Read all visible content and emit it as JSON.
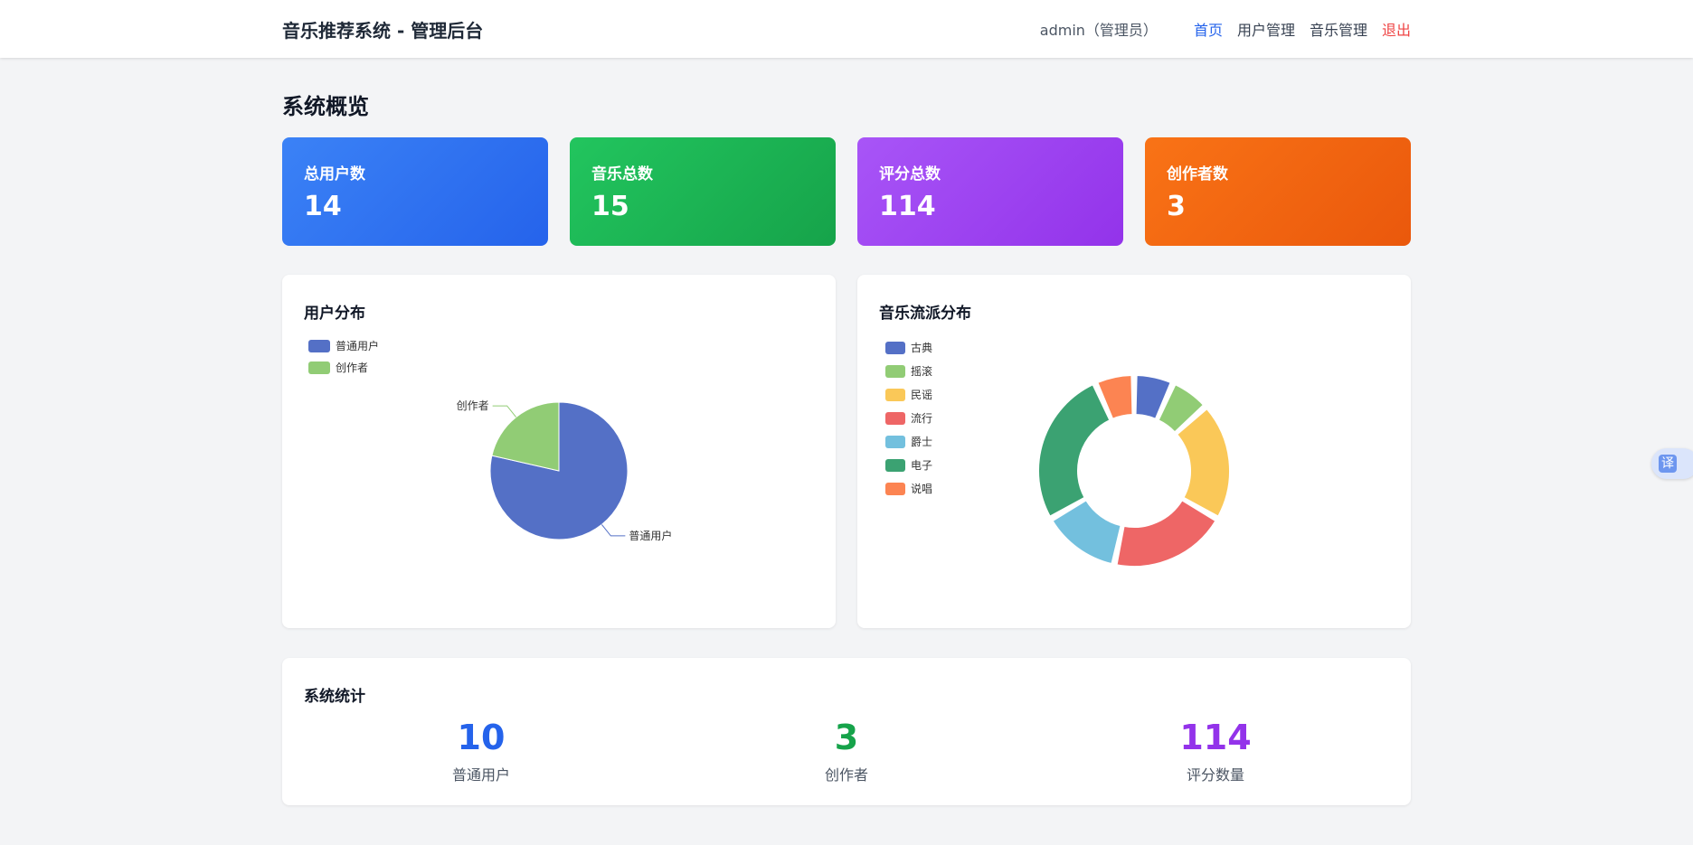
{
  "header": {
    "brand": "音乐推荐系统 - 管理后台",
    "user": "admin（管理员）",
    "nav": [
      {
        "label": "首页",
        "active": true
      },
      {
        "label": "用户管理",
        "active": false
      },
      {
        "label": "音乐管理",
        "active": false
      },
      {
        "label": "退出",
        "active": false
      }
    ]
  },
  "page_title": "系统概览",
  "stats": [
    {
      "label": "总用户数",
      "value": "14"
    },
    {
      "label": "音乐总数",
      "value": "15"
    },
    {
      "label": "评分总数",
      "value": "114"
    },
    {
      "label": "创作者数",
      "value": "3"
    }
  ],
  "charts": {
    "users_title": "用户分布",
    "genre_title": "音乐流派分布"
  },
  "chart_data": [
    {
      "type": "pie",
      "title": "用户分布",
      "categories": [
        "普通用户",
        "创作者"
      ],
      "values": [
        11,
        3
      ],
      "colors": [
        "#5470c6",
        "#91cc75"
      ],
      "legend": "top-left"
    },
    {
      "type": "pie",
      "title": "音乐流派分布",
      "categories": [
        "古典",
        "摇滚",
        "民谣",
        "流行",
        "爵士",
        "电子",
        "说唱"
      ],
      "values": [
        1,
        1,
        3,
        3,
        2,
        4,
        1
      ],
      "colors": [
        "#5470c6",
        "#91cc75",
        "#fac858",
        "#ee6666",
        "#73c0de",
        "#3ba272",
        "#fc8452"
      ],
      "legend": "top-left"
    }
  ],
  "system": {
    "title": "系统统计",
    "items": [
      {
        "value": "10",
        "label": "普通用户"
      },
      {
        "value": "3",
        "label": "创作者"
      },
      {
        "value": "114",
        "label": "评分数量"
      }
    ]
  },
  "translate_label": "译"
}
